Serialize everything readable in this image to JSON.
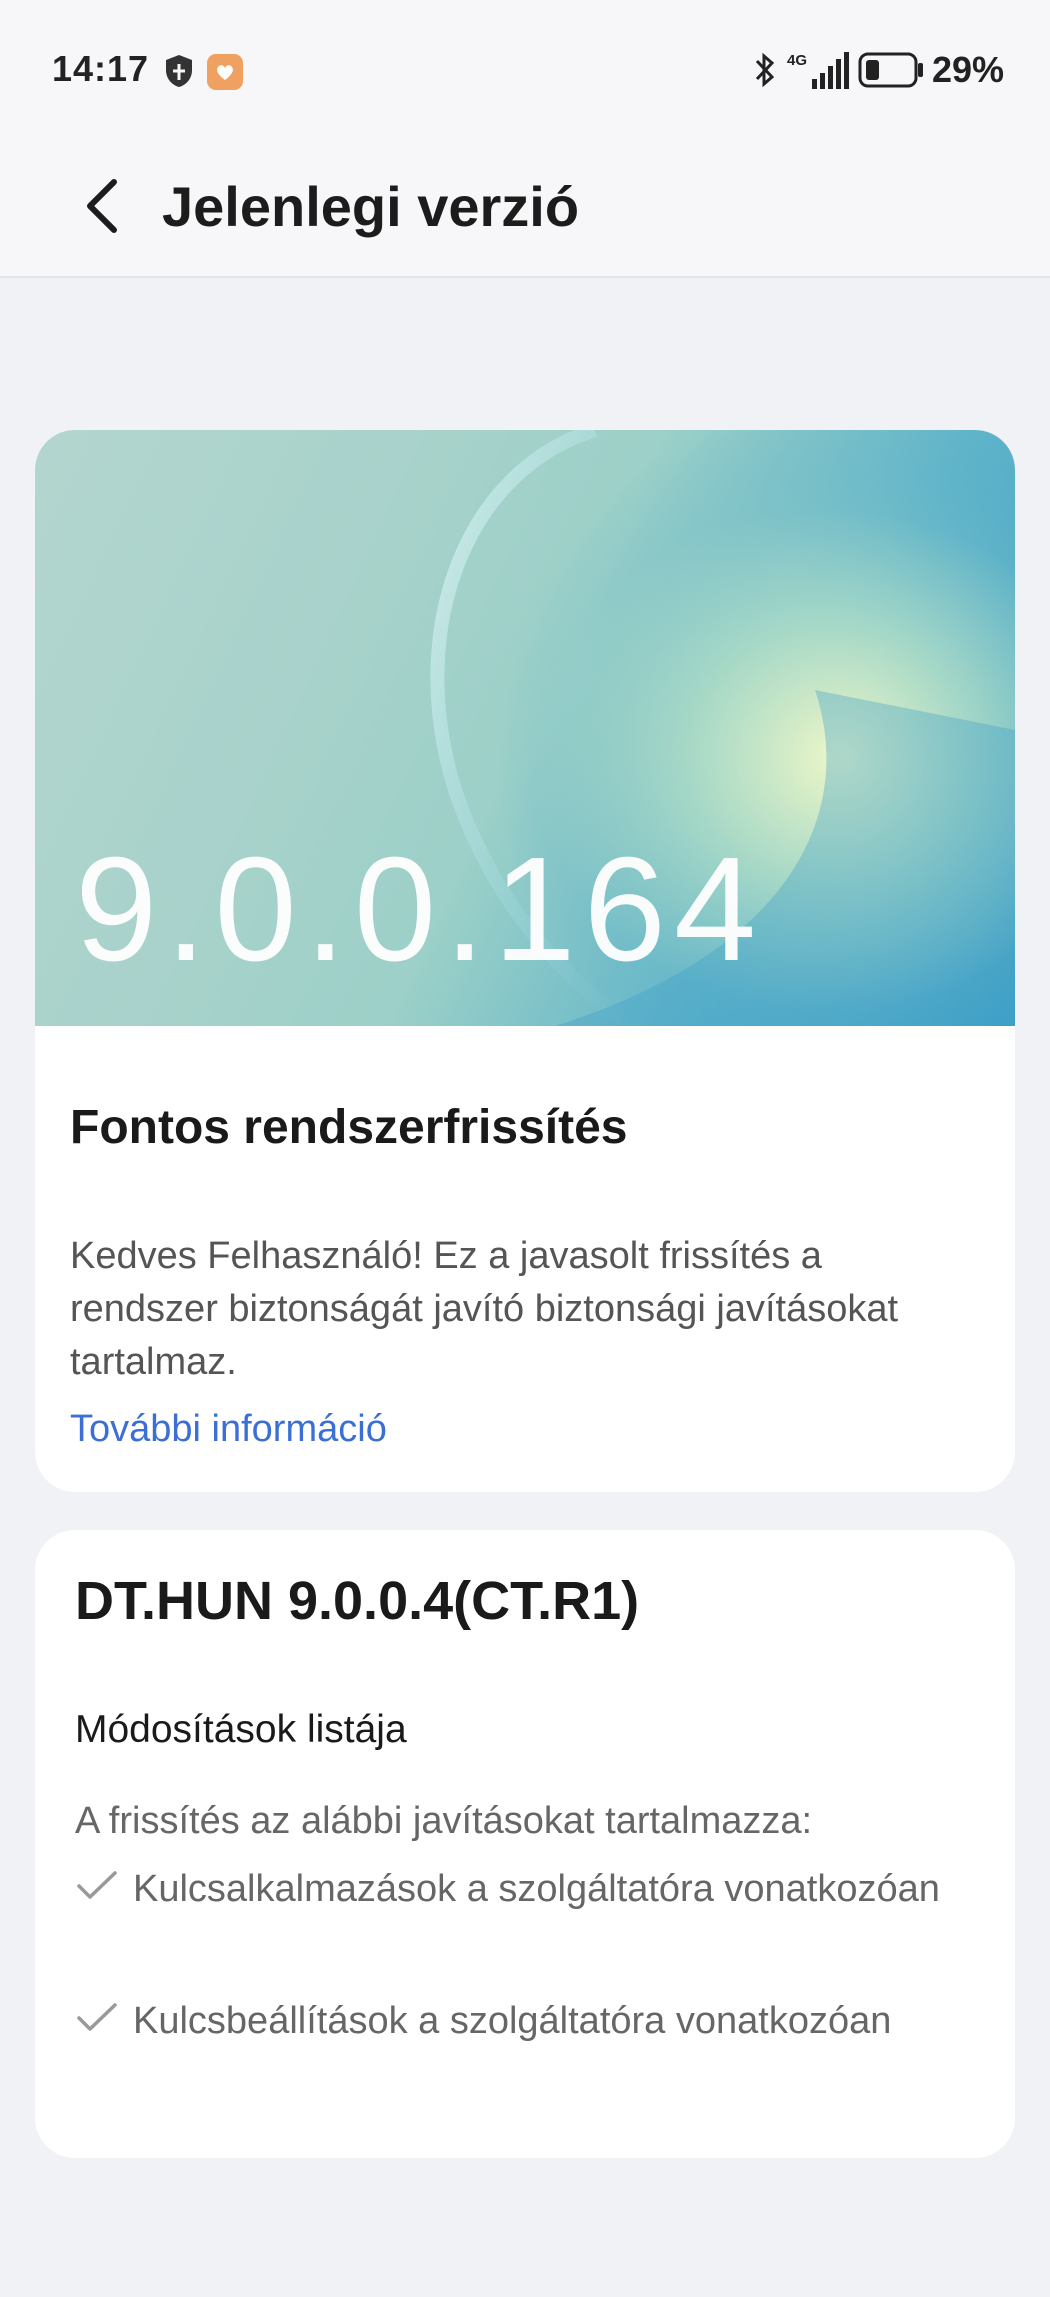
{
  "status_bar": {
    "time": "14:17",
    "network": "4G",
    "battery_percent": "29%",
    "battery_level": 0.29,
    "icons": [
      "shield-icon",
      "app-notification-icon",
      "bluetooth-icon",
      "signal-icon",
      "battery-icon"
    ]
  },
  "app_bar": {
    "title": "Jelenlegi verzió",
    "back_icon": "chevron-left-icon"
  },
  "update_card": {
    "version": "9.0.0.164",
    "title": "Fontos rendszerfrissítés",
    "description": "Kedves Felhasználó! Ez a javasolt frissítés a rendszer biztonságát javító biztonsági javításokat tartalmaz.",
    "more_link": "További információ",
    "link_color": "#3b6fd6"
  },
  "changelog_card": {
    "build": "DT.HUN 9.0.0.4(CT.R1)",
    "section_title": "Módosítások listája",
    "intro": "A frissítés az alábbi javításokat tartalmazza:",
    "items": [
      {
        "text": "Kulcsalkalmazások a szolgáltatóra vonatkozóan"
      },
      {
        "text": "Kulcsbeállítások a szolgáltatóra vonatkozóan"
      }
    ]
  }
}
